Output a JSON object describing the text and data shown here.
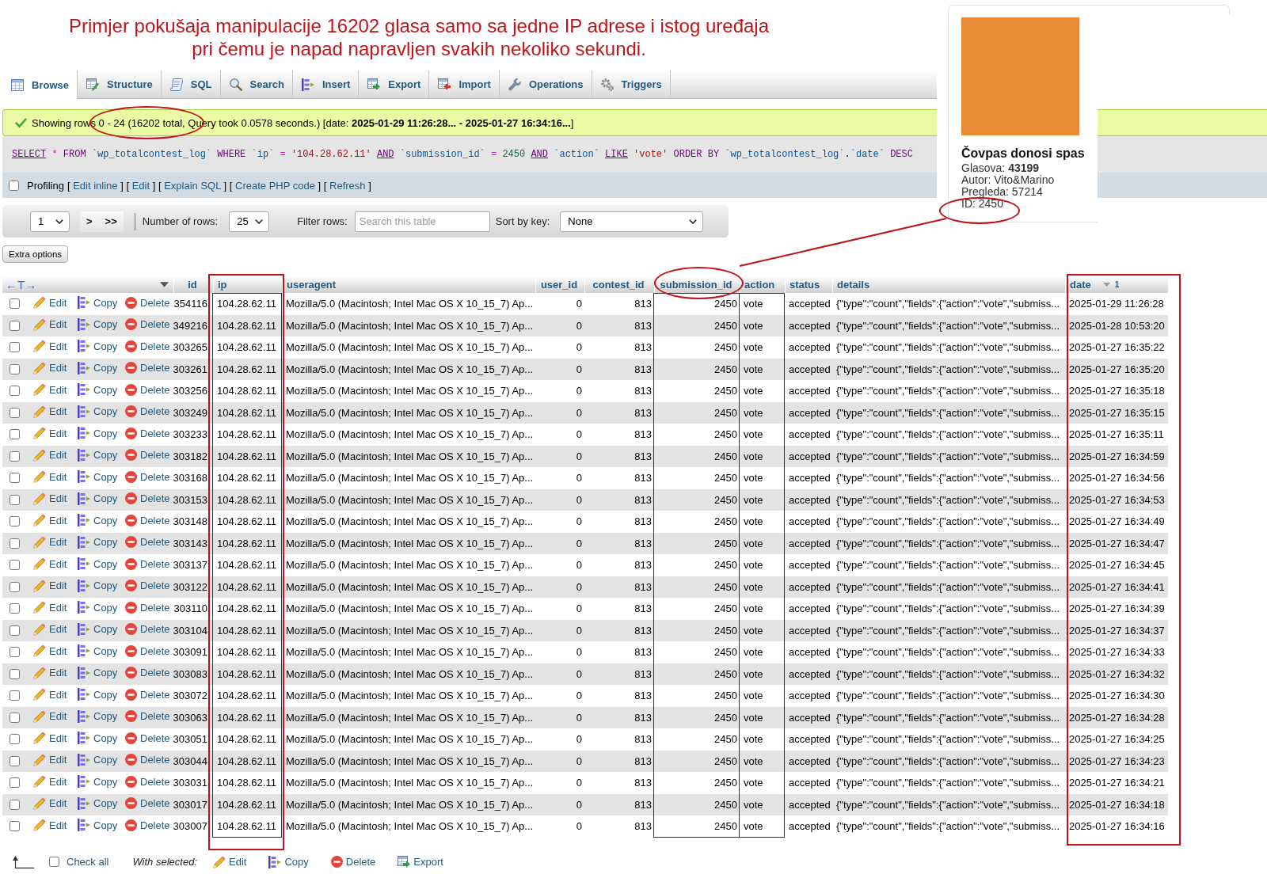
{
  "annotation": {
    "lines": [
      "Primjer pokušaja manipulacije 16202 glasa samo sa jedne IP adrese i istog uređaja",
      "pri čemu je napad napravljen svakih nekoliko sekundi."
    ]
  },
  "tabs": [
    {
      "label": "Browse",
      "selected": true
    },
    {
      "label": "Structure",
      "selected": false
    },
    {
      "label": "SQL",
      "selected": false
    },
    {
      "label": "Search",
      "selected": false
    },
    {
      "label": "Insert",
      "selected": false
    },
    {
      "label": "Export",
      "selected": false
    },
    {
      "label": "Import",
      "selected": false
    },
    {
      "label": "Operations",
      "selected": false
    },
    {
      "label": "Triggers",
      "selected": false
    }
  ],
  "message": {
    "text": "Showing rows 0 - 24 (16202 total, Query took 0.0578 seconds.) [date: **2025-01-29 11:26:28... - 2025-01-27 16:34:16...**]"
  },
  "sql": {
    "tokens": [
      {
        "text": "SELECT",
        "kind": "link"
      },
      {
        "text": "*",
        "kind": "operator"
      },
      {
        "text": "FROM",
        "kind": "keyword"
      },
      {
        "text": "`wp_totalcontest_log`",
        "kind": "identifier"
      },
      {
        "text": "WHERE",
        "kind": "keyword"
      },
      {
        "text": "`ip`",
        "kind": "identifier"
      },
      {
        "text": "=",
        "kind": "operator"
      },
      {
        "text": "'104.28.62.11'",
        "kind": "string"
      },
      {
        "text": "AND",
        "kind": "link"
      },
      {
        "text": "`submission_id`",
        "kind": "identifier"
      },
      {
        "text": "=",
        "kind": "operator"
      },
      {
        "text": "2450",
        "kind": "number"
      },
      {
        "text": "AND",
        "kind": "link"
      },
      {
        "text": "`action`",
        "kind": "identifier"
      },
      {
        "text": "LIKE",
        "kind": "link"
      },
      {
        "text": "'vote'",
        "kind": "string"
      },
      {
        "text": "ORDER BY",
        "kind": "keyword"
      },
      {
        "text": "`wp_totalcontest_log`",
        "kind": "identifier"
      },
      {
        "text": ".",
        "kind": "punct"
      },
      {
        "text": "`date`",
        "kind": "identifier"
      },
      {
        "text": "DESC",
        "kind": "keyword"
      }
    ]
  },
  "profiling": {
    "checked": false,
    "label": "Profiling",
    "links": [
      {
        "open": "[",
        "label": "Edit inline",
        "close": "]"
      },
      {
        "open": "[",
        "label": "Edit",
        "close": "]"
      },
      {
        "open": "[",
        "label": "Explain SQL",
        "close": "]"
      },
      {
        "open": "[",
        "label": "Create PHP code",
        "close": "]"
      },
      {
        "open": "[",
        "label": "Refresh",
        "close": "]"
      }
    ]
  },
  "navigation": {
    "page": "1",
    "buttons": [
      ">",
      ">>"
    ],
    "rows_label": "Number of rows:",
    "rows_value": "25",
    "filter": {
      "label": "Filter rows:",
      "placeholder": "Search this table"
    },
    "sort_label": "Sort by key:",
    "sort_value": "None"
  },
  "extra_options": "Extra options",
  "table": {
    "toggle": "←T→",
    "columns": [
      {
        "label": "id",
        "kind": "number",
        "condition": false,
        "sorted": false
      },
      {
        "label": "ip",
        "kind": "text",
        "condition": true,
        "sorted": false
      },
      {
        "label": "useragent",
        "kind": "text",
        "condition": false,
        "sorted": false
      },
      {
        "label": "user_id",
        "kind": "number",
        "condition": false,
        "sorted": false
      },
      {
        "label": "contest_id",
        "kind": "number",
        "condition": false,
        "sorted": false
      },
      {
        "label": "submission_id",
        "kind": "number",
        "condition": true,
        "sorted": false
      },
      {
        "label": "action",
        "kind": "text",
        "condition": true,
        "sorted": false
      },
      {
        "label": "status",
        "kind": "text",
        "condition": false,
        "sorted": false
      },
      {
        "label": "details",
        "kind": "text",
        "condition": false,
        "sorted": false
      },
      {
        "label": "date",
        "kind": "text",
        "condition": false,
        "sorted": true,
        "sort_rank": "1"
      }
    ],
    "rows": [
      {
        "checked": false,
        "actions": [
          "Edit",
          "Copy",
          "Delete"
        ],
        "cells": [
          "354116",
          "104.28.62.11",
          "Mozilla/5.0 (Macintosh; Intel Mac OS X 10_15_7) Ap...",
          "0",
          "813",
          "2450",
          "vote",
          "accepted",
          "{\"type\":\"count\",\"fields\":{\"action\":\"vote\",\"submiss...",
          "2025-01-29 11:26:28"
        ]
      },
      {
        "checked": false,
        "actions": [
          "Edit",
          "Copy",
          "Delete"
        ],
        "cells": [
          "349216",
          "104.28.62.11",
          "Mozilla/5.0 (Macintosh; Intel Mac OS X 10_15_7) Ap...",
          "0",
          "813",
          "2450",
          "vote",
          "accepted",
          "{\"type\":\"count\",\"fields\":{\"action\":\"vote\",\"submiss...",
          "2025-01-28 10:53:20"
        ]
      },
      {
        "checked": false,
        "actions": [
          "Edit",
          "Copy",
          "Delete"
        ],
        "cells": [
          "303265",
          "104.28.62.11",
          "Mozilla/5.0 (Macintosh; Intel Mac OS X 10_15_7) Ap...",
          "0",
          "813",
          "2450",
          "vote",
          "accepted",
          "{\"type\":\"count\",\"fields\":{\"action\":\"vote\",\"submiss...",
          "2025-01-27 16:35:22"
        ]
      },
      {
        "checked": false,
        "actions": [
          "Edit",
          "Copy",
          "Delete"
        ],
        "cells": [
          "303261",
          "104.28.62.11",
          "Mozilla/5.0 (Macintosh; Intel Mac OS X 10_15_7) Ap...",
          "0",
          "813",
          "2450",
          "vote",
          "accepted",
          "{\"type\":\"count\",\"fields\":{\"action\":\"vote\",\"submiss...",
          "2025-01-27 16:35:20"
        ]
      },
      {
        "checked": false,
        "actions": [
          "Edit",
          "Copy",
          "Delete"
        ],
        "cells": [
          "303256",
          "104.28.62.11",
          "Mozilla/5.0 (Macintosh; Intel Mac OS X 10_15_7) Ap...",
          "0",
          "813",
          "2450",
          "vote",
          "accepted",
          "{\"type\":\"count\",\"fields\":{\"action\":\"vote\",\"submiss...",
          "2025-01-27 16:35:18"
        ]
      },
      {
        "checked": false,
        "actions": [
          "Edit",
          "Copy",
          "Delete"
        ],
        "cells": [
          "303249",
          "104.28.62.11",
          "Mozilla/5.0 (Macintosh; Intel Mac OS X 10_15_7) Ap...",
          "0",
          "813",
          "2450",
          "vote",
          "accepted",
          "{\"type\":\"count\",\"fields\":{\"action\":\"vote\",\"submiss...",
          "2025-01-27 16:35:15"
        ]
      },
      {
        "checked": false,
        "actions": [
          "Edit",
          "Copy",
          "Delete"
        ],
        "cells": [
          "303233",
          "104.28.62.11",
          "Mozilla/5.0 (Macintosh; Intel Mac OS X 10_15_7) Ap...",
          "0",
          "813",
          "2450",
          "vote",
          "accepted",
          "{\"type\":\"count\",\"fields\":{\"action\":\"vote\",\"submiss...",
          "2025-01-27 16:35:11"
        ]
      },
      {
        "checked": false,
        "actions": [
          "Edit",
          "Copy",
          "Delete"
        ],
        "cells": [
          "303182",
          "104.28.62.11",
          "Mozilla/5.0 (Macintosh; Intel Mac OS X 10_15_7) Ap...",
          "0",
          "813",
          "2450",
          "vote",
          "accepted",
          "{\"type\":\"count\",\"fields\":{\"action\":\"vote\",\"submiss...",
          "2025-01-27 16:34:59"
        ]
      },
      {
        "checked": false,
        "actions": [
          "Edit",
          "Copy",
          "Delete"
        ],
        "cells": [
          "303168",
          "104.28.62.11",
          "Mozilla/5.0 (Macintosh; Intel Mac OS X 10_15_7) Ap...",
          "0",
          "813",
          "2450",
          "vote",
          "accepted",
          "{\"type\":\"count\",\"fields\":{\"action\":\"vote\",\"submiss...",
          "2025-01-27 16:34:56"
        ]
      },
      {
        "checked": false,
        "actions": [
          "Edit",
          "Copy",
          "Delete"
        ],
        "cells": [
          "303153",
          "104.28.62.11",
          "Mozilla/5.0 (Macintosh; Intel Mac OS X 10_15_7) Ap...",
          "0",
          "813",
          "2450",
          "vote",
          "accepted",
          "{\"type\":\"count\",\"fields\":{\"action\":\"vote\",\"submiss...",
          "2025-01-27 16:34:53"
        ]
      },
      {
        "checked": false,
        "actions": [
          "Edit",
          "Copy",
          "Delete"
        ],
        "cells": [
          "303148",
          "104.28.62.11",
          "Mozilla/5.0 (Macintosh; Intel Mac OS X 10_15_7) Ap...",
          "0",
          "813",
          "2450",
          "vote",
          "accepted",
          "{\"type\":\"count\",\"fields\":{\"action\":\"vote\",\"submiss...",
          "2025-01-27 16:34:49"
        ]
      },
      {
        "checked": false,
        "actions": [
          "Edit",
          "Copy",
          "Delete"
        ],
        "cells": [
          "303143",
          "104.28.62.11",
          "Mozilla/5.0 (Macintosh; Intel Mac OS X 10_15_7) Ap...",
          "0",
          "813",
          "2450",
          "vote",
          "accepted",
          "{\"type\":\"count\",\"fields\":{\"action\":\"vote\",\"submiss...",
          "2025-01-27 16:34:47"
        ]
      },
      {
        "checked": false,
        "actions": [
          "Edit",
          "Copy",
          "Delete"
        ],
        "cells": [
          "303137",
          "104.28.62.11",
          "Mozilla/5.0 (Macintosh; Intel Mac OS X 10_15_7) Ap...",
          "0",
          "813",
          "2450",
          "vote",
          "accepted",
          "{\"type\":\"count\",\"fields\":{\"action\":\"vote\",\"submiss...",
          "2025-01-27 16:34:45"
        ]
      },
      {
        "checked": false,
        "actions": [
          "Edit",
          "Copy",
          "Delete"
        ],
        "cells": [
          "303122",
          "104.28.62.11",
          "Mozilla/5.0 (Macintosh; Intel Mac OS X 10_15_7) Ap...",
          "0",
          "813",
          "2450",
          "vote",
          "accepted",
          "{\"type\":\"count\",\"fields\":{\"action\":\"vote\",\"submiss...",
          "2025-01-27 16:34:41"
        ]
      },
      {
        "checked": false,
        "actions": [
          "Edit",
          "Copy",
          "Delete"
        ],
        "cells": [
          "303110",
          "104.28.62.11",
          "Mozilla/5.0 (Macintosh; Intel Mac OS X 10_15_7) Ap...",
          "0",
          "813",
          "2450",
          "vote",
          "accepted",
          "{\"type\":\"count\",\"fields\":{\"action\":\"vote\",\"submiss...",
          "2025-01-27 16:34:39"
        ]
      },
      {
        "checked": false,
        "actions": [
          "Edit",
          "Copy",
          "Delete"
        ],
        "cells": [
          "303104",
          "104.28.62.11",
          "Mozilla/5.0 (Macintosh; Intel Mac OS X 10_15_7) Ap...",
          "0",
          "813",
          "2450",
          "vote",
          "accepted",
          "{\"type\":\"count\",\"fields\":{\"action\":\"vote\",\"submiss...",
          "2025-01-27 16:34:37"
        ]
      },
      {
        "checked": false,
        "actions": [
          "Edit",
          "Copy",
          "Delete"
        ],
        "cells": [
          "303091",
          "104.28.62.11",
          "Mozilla/5.0 (Macintosh; Intel Mac OS X 10_15_7) Ap...",
          "0",
          "813",
          "2450",
          "vote",
          "accepted",
          "{\"type\":\"count\",\"fields\":{\"action\":\"vote\",\"submiss...",
          "2025-01-27 16:34:33"
        ]
      },
      {
        "checked": false,
        "actions": [
          "Edit",
          "Copy",
          "Delete"
        ],
        "cells": [
          "303083",
          "104.28.62.11",
          "Mozilla/5.0 (Macintosh; Intel Mac OS X 10_15_7) Ap...",
          "0",
          "813",
          "2450",
          "vote",
          "accepted",
          "{\"type\":\"count\",\"fields\":{\"action\":\"vote\",\"submiss...",
          "2025-01-27 16:34:32"
        ]
      },
      {
        "checked": false,
        "actions": [
          "Edit",
          "Copy",
          "Delete"
        ],
        "cells": [
          "303072",
          "104.28.62.11",
          "Mozilla/5.0 (Macintosh; Intel Mac OS X 10_15_7) Ap...",
          "0",
          "813",
          "2450",
          "vote",
          "accepted",
          "{\"type\":\"count\",\"fields\":{\"action\":\"vote\",\"submiss...",
          "2025-01-27 16:34:30"
        ]
      },
      {
        "checked": false,
        "actions": [
          "Edit",
          "Copy",
          "Delete"
        ],
        "cells": [
          "303063",
          "104.28.62.11",
          "Mozilla/5.0 (Macintosh; Intel Mac OS X 10_15_7) Ap...",
          "0",
          "813",
          "2450",
          "vote",
          "accepted",
          "{\"type\":\"count\",\"fields\":{\"action\":\"vote\",\"submiss...",
          "2025-01-27 16:34:28"
        ]
      },
      {
        "checked": false,
        "actions": [
          "Edit",
          "Copy",
          "Delete"
        ],
        "cells": [
          "303051",
          "104.28.62.11",
          "Mozilla/5.0 (Macintosh; Intel Mac OS X 10_15_7) Ap...",
          "0",
          "813",
          "2450",
          "vote",
          "accepted",
          "{\"type\":\"count\",\"fields\":{\"action\":\"vote\",\"submiss...",
          "2025-01-27 16:34:25"
        ]
      },
      {
        "checked": false,
        "actions": [
          "Edit",
          "Copy",
          "Delete"
        ],
        "cells": [
          "303044",
          "104.28.62.11",
          "Mozilla/5.0 (Macintosh; Intel Mac OS X 10_15_7) Ap...",
          "0",
          "813",
          "2450",
          "vote",
          "accepted",
          "{\"type\":\"count\",\"fields\":{\"action\":\"vote\",\"submiss...",
          "2025-01-27 16:34:23"
        ]
      },
      {
        "checked": false,
        "actions": [
          "Edit",
          "Copy",
          "Delete"
        ],
        "cells": [
          "303031",
          "104.28.62.11",
          "Mozilla/5.0 (Macintosh; Intel Mac OS X 10_15_7) Ap...",
          "0",
          "813",
          "2450",
          "vote",
          "accepted",
          "{\"type\":\"count\",\"fields\":{\"action\":\"vote\",\"submiss...",
          "2025-01-27 16:34:21"
        ]
      },
      {
        "checked": false,
        "actions": [
          "Edit",
          "Copy",
          "Delete"
        ],
        "cells": [
          "303017",
          "104.28.62.11",
          "Mozilla/5.0 (Macintosh; Intel Mac OS X 10_15_7) Ap...",
          "0",
          "813",
          "2450",
          "vote",
          "accepted",
          "{\"type\":\"count\",\"fields\":{\"action\":\"vote\",\"submiss...",
          "2025-01-27 16:34:18"
        ]
      },
      {
        "checked": false,
        "actions": [
          "Edit",
          "Copy",
          "Delete"
        ],
        "cells": [
          "303007",
          "104.28.62.11",
          "Mozilla/5.0 (Macintosh; Intel Mac OS X 10_15_7) Ap...",
          "0",
          "813",
          "2450",
          "vote",
          "accepted",
          "{\"type\":\"count\",\"fields\":{\"action\":\"vote\",\"submiss...",
          "2025-01-27 16:34:16"
        ]
      }
    ]
  },
  "footer": {
    "check_all": {
      "label": "Check all",
      "checked": false
    },
    "with_selected": "With selected:",
    "actions": [
      "Edit",
      "Copy",
      "Delete",
      "Export"
    ]
  },
  "card": {
    "title": "Čovpas donosi spas",
    "lines": [
      "Glasova: **43199**",
      "Autor: Vito&Marino",
      "Pregleda: 57214",
      "ID: 2450"
    ]
  }
}
